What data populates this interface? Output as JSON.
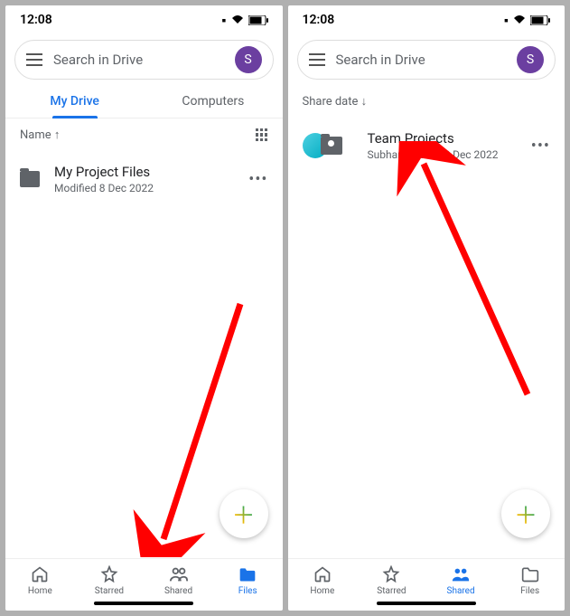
{
  "left": {
    "status_time": "12:08",
    "search_placeholder": "Search in Drive",
    "avatar_letter": "S",
    "tabs": [
      "My Drive",
      "Computers"
    ],
    "sort_label": "Name ↑",
    "file": {
      "name": "My Project Files",
      "meta": "Modified 8 Dec 2022"
    },
    "nav": {
      "home": "Home",
      "starred": "Starred",
      "shared": "Shared",
      "files": "Files"
    }
  },
  "right": {
    "status_time": "12:08",
    "search_placeholder": "Search in Drive",
    "avatar_letter": "S",
    "sort_label": "Share date ↓",
    "file": {
      "name": "Team Projects",
      "meta": "Subham Stark • 8 Dec 2022"
    },
    "nav": {
      "home": "Home",
      "starred": "Starred",
      "shared": "Shared",
      "files": "Files"
    }
  }
}
